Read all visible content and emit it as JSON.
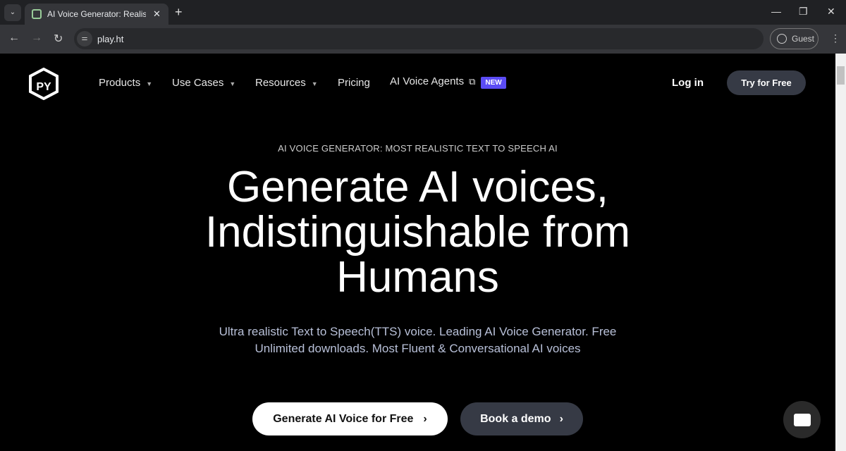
{
  "browser": {
    "tab_title": "AI Voice Generator: Realistic Text to Speech",
    "url": "play.ht",
    "profile": "Guest"
  },
  "nav": {
    "items": [
      {
        "label": "Products"
      },
      {
        "label": "Use Cases"
      },
      {
        "label": "Resources"
      },
      {
        "label": "Pricing"
      },
      {
        "label": "AI Voice Agents"
      }
    ],
    "new_badge": "NEW",
    "login": "Log in",
    "try": "Try for Free"
  },
  "hero": {
    "eyebrow": "AI VOICE GENERATOR: MOST REALISTIC TEXT TO SPEECH AI",
    "title_lines": [
      "Generate AI voices,",
      "Indistinguishable from",
      "Humans"
    ],
    "sub_lines": [
      "Ultra realistic Text to Speech(TTS) voice. Leading AI Voice Generator. Free",
      "Unlimited downloads. Most Fluent & Conversational AI voices"
    ],
    "cta_primary": "Generate AI Voice for Free",
    "cta_secondary": "Book a demo"
  },
  "colors": {
    "accent": "#5b4cf5",
    "button_dark": "#363a45"
  }
}
